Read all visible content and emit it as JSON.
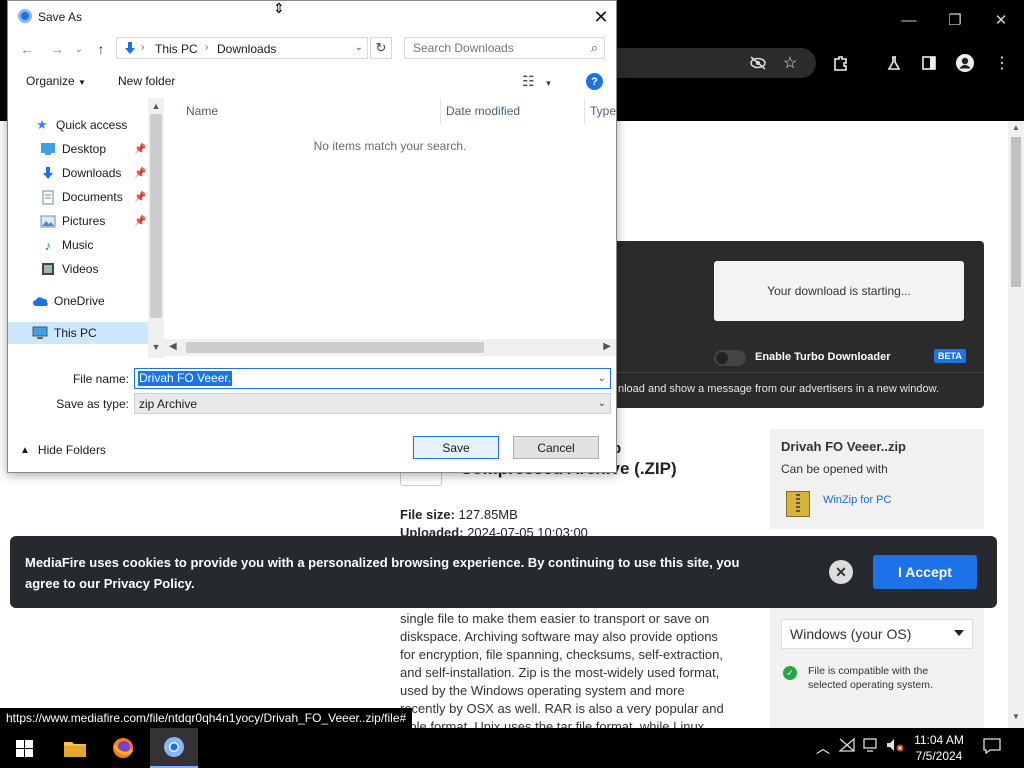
{
  "browser": {
    "window_controls": {
      "minimize": "—",
      "maximize": "❐",
      "close": "✕"
    }
  },
  "page": {
    "download_starting": "Your download is starting...",
    "turbo_label": "Enable Turbo Downloader",
    "beta_badge": "BETA",
    "dl_note": "nload and show a message from our advertisers in a new window.",
    "file_type_partial": "p",
    "file_type_title": "Compressed Archive (.ZIP)",
    "file_size_label": "File size:",
    "file_size_value": "127.85MB",
    "uploaded_label": "Uploaded:",
    "uploaded_value": "2024-07-05 10:03:00",
    "article_lines": [
      "single file to make them easier to transport or save on",
      "diskspace. Archiving software may also provide options",
      "for encryption, file spanning, checksums, self-extraction,",
      "and self-installation. Zip is the most-widely used format,",
      "used by the Windows operating system and more",
      "recently by OSX as well. RAR is also a very popular and",
      "xible format. Unix uses the tar file format, while Linux"
    ],
    "side_card": {
      "filename": "Drivah FO Veeer..zip",
      "opened_with": "Can be opened with",
      "app_link": "WinZip for PC"
    },
    "os_select": "Windows (your OS)",
    "compat_text": "File is compatible with the selected operating system.",
    "cookie_text": "MediaFire uses cookies to provide you with a personalized browsing experience. By continuing to use this site, you agree to our Privacy Policy.",
    "cookie_close": "✕",
    "cookie_accept": "I Accept",
    "status_url": "https://www.mediafire.com/file/ntdqr0qh4n1yocy/Drivah_FO_Veeer..zip/file#"
  },
  "dialog": {
    "title": "Save As",
    "breadcrumb": [
      "This PC",
      "Downloads"
    ],
    "search_placeholder": "Search Downloads",
    "organize": "Organize",
    "new_folder": "New folder",
    "nav_items": [
      {
        "label": "Quick access",
        "icon": "star-icon"
      },
      {
        "label": "Desktop",
        "icon": "desktop-icon"
      },
      {
        "label": "Downloads",
        "icon": "download-arrow-icon"
      },
      {
        "label": "Documents",
        "icon": "document-icon"
      },
      {
        "label": "Pictures",
        "icon": "pictures-icon"
      },
      {
        "label": "Music",
        "icon": "music-icon"
      },
      {
        "label": "Videos",
        "icon": "video-icon"
      },
      {
        "label": "OneDrive",
        "icon": "cloud-icon"
      },
      {
        "label": "This PC",
        "icon": "computer-icon"
      }
    ],
    "columns": [
      "Name",
      "Date modified",
      "Type"
    ],
    "empty_message": "No items match your search.",
    "file_name_label": "File name:",
    "file_name_value": "Drivah FO Veeer.",
    "save_type_label": "Save as type:",
    "save_type_value": "zip Archive",
    "hide_folders": "Hide Folders",
    "save_button": "Save",
    "cancel_button": "Cancel"
  },
  "taskbar": {
    "time": "11:04 AM",
    "date": "7/5/2024"
  },
  "colors": {
    "accent": "#1a73e8",
    "mediafire_blue": "#1d72e8",
    "cookie_bg": "#26292d",
    "dark_panel": "#2b2b2b"
  }
}
